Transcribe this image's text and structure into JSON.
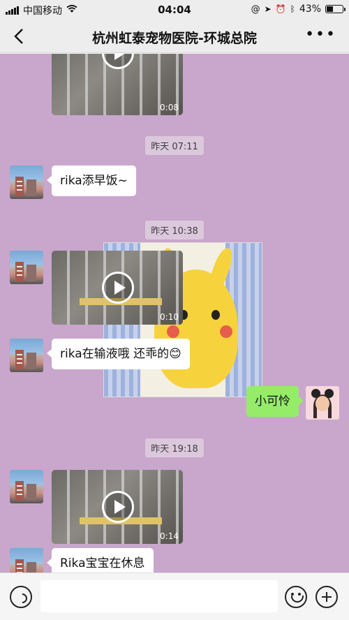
{
  "status_bar": {
    "carrier": "中国移动",
    "time": "04:04",
    "battery_percent": "43%",
    "battery_level": 0.43
  },
  "header": {
    "title": "杭州虹泰宠物医院-环城总院",
    "more_label": "•••"
  },
  "messages": [
    {
      "type": "video",
      "side": "left",
      "duration": "0:08"
    },
    {
      "type": "time",
      "text": "昨天 07:11"
    },
    {
      "type": "text",
      "side": "left",
      "text": "rika添早饭~"
    },
    {
      "type": "time",
      "text": "昨天 10:38"
    },
    {
      "type": "video",
      "side": "left",
      "duration": "0:10"
    },
    {
      "type": "text",
      "side": "left",
      "text": "rika在输液哦   还乖的😊"
    },
    {
      "type": "sticker",
      "side": "left",
      "icon": "pikachu-sticker"
    },
    {
      "type": "text",
      "side": "right",
      "text": "小可怜"
    },
    {
      "type": "time",
      "text": "昨天 19:18"
    },
    {
      "type": "video",
      "side": "left",
      "duration": "0:14"
    },
    {
      "type": "text",
      "side": "left",
      "text": "Rika宝宝在休息"
    }
  ],
  "colors": {
    "chat_background": "#c9a6cb",
    "outgoing_bubble": "#95ec69",
    "incoming_bubble": "#ffffff"
  }
}
